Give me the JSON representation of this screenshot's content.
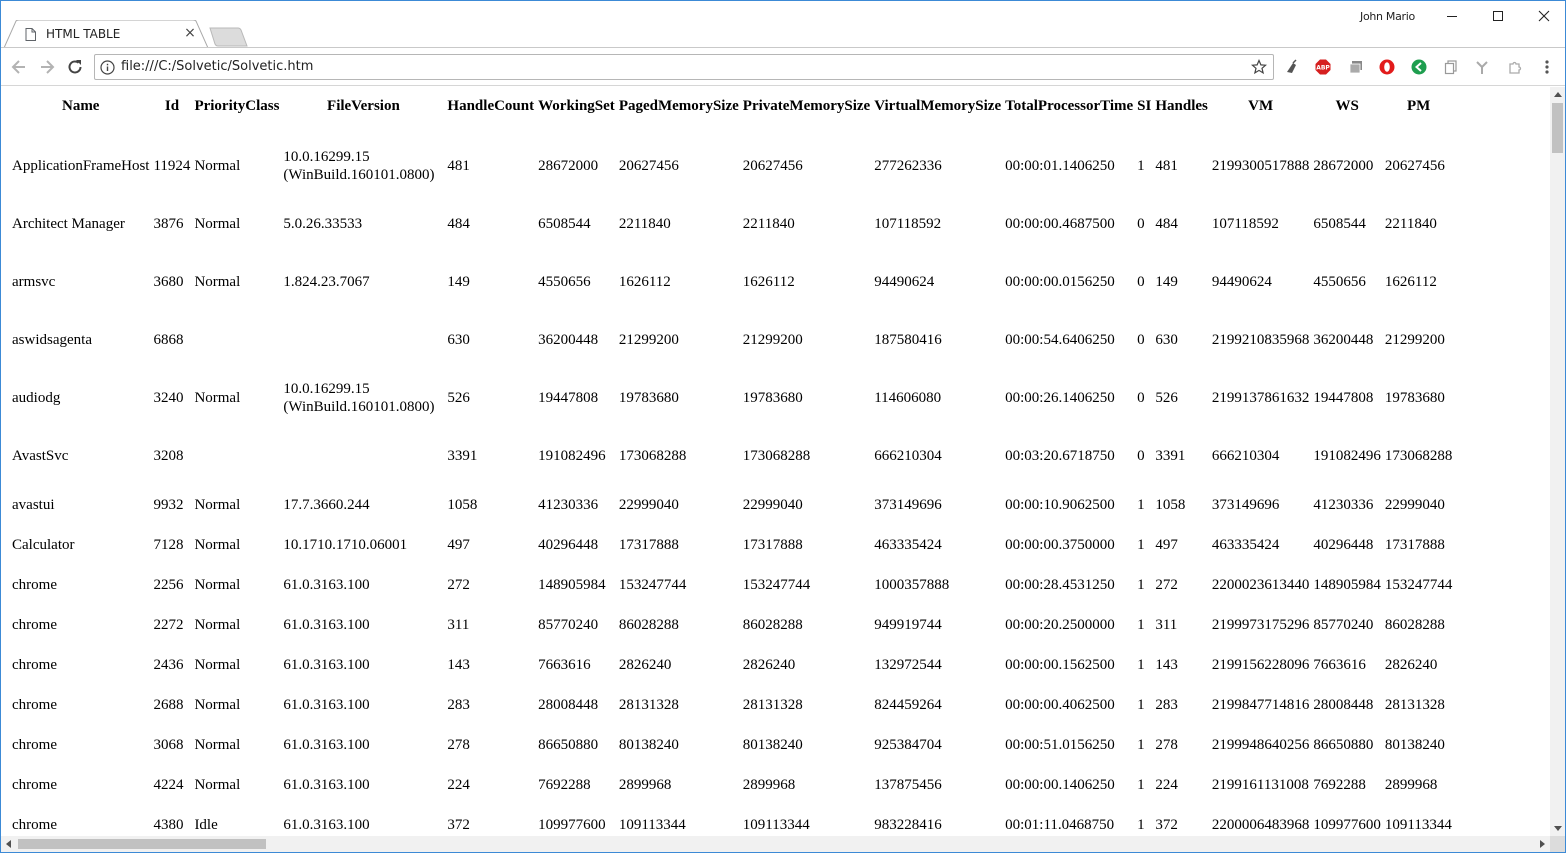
{
  "tab": {
    "title": "HTML TABLE"
  },
  "profile": {
    "name": "John Mario"
  },
  "omnibox": {
    "url": "file:///C:/Solvetic/Solvetic.htm"
  },
  "table": {
    "headers": [
      "Name",
      "Id",
      "PriorityClass",
      "FileVersion",
      "HandleCount",
      "WorkingSet",
      "PagedMemorySize",
      "PrivateMemorySize",
      "VirtualMemorySize",
      "TotalProcessorTime",
      "SI",
      "Handles",
      "VM",
      "WS",
      "PM"
    ],
    "rows": [
      {
        "cells": [
          "ApplicationFrameHost",
          "11924",
          "Normal",
          "10.0.16299.15 (WinBuild.160101.0800)",
          "481",
          "28672000",
          "20627456",
          "20627456",
          "277262336",
          "00:00:01.1406250",
          "1",
          "481",
          "2199300517888",
          "28672000",
          "20627456"
        ]
      },
      {
        "cells": [
          "Architect Manager",
          "3876",
          "Normal",
          "5.0.26.33533",
          "484",
          "6508544",
          "2211840",
          "2211840",
          "107118592",
          "00:00:00.4687500",
          "0",
          "484",
          "107118592",
          "6508544",
          "2211840"
        ]
      },
      {
        "cells": [
          "armsvc",
          "3680",
          "Normal",
          "1.824.23.7067",
          "149",
          "4550656",
          "1626112",
          "1626112",
          "94490624",
          "00:00:00.0156250",
          "0",
          "149",
          "94490624",
          "4550656",
          "1626112"
        ]
      },
      {
        "cells": [
          "aswidsagenta",
          "6868",
          "",
          "",
          "630",
          "36200448",
          "21299200",
          "21299200",
          "187580416",
          "00:00:54.6406250",
          "0",
          "630",
          "2199210835968",
          "36200448",
          "21299200"
        ]
      },
      {
        "cells": [
          "audiodg",
          "3240",
          "Normal",
          "10.0.16299.15 (WinBuild.160101.0800)",
          "526",
          "19447808",
          "19783680",
          "19783680",
          "114606080",
          "00:00:26.1406250",
          "0",
          "526",
          "2199137861632",
          "19447808",
          "19783680"
        ]
      },
      {
        "cells": [
          "AvastSvc",
          "3208",
          "",
          "",
          "3391",
          "191082496",
          "173068288",
          "173068288",
          "666210304",
          "00:03:20.6718750",
          "0",
          "3391",
          "666210304",
          "191082496",
          "173068288"
        ]
      },
      {
        "cells": [
          "avastui",
          "9932",
          "Normal",
          "17.7.3660.244",
          "1058",
          "41230336",
          "22999040",
          "22999040",
          "373149696",
          "00:00:10.9062500",
          "1",
          "1058",
          "373149696",
          "41230336",
          "22999040"
        ]
      },
      {
        "cells": [
          "Calculator",
          "7128",
          "Normal",
          "10.1710.1710.06001",
          "497",
          "40296448",
          "17317888",
          "17317888",
          "463335424",
          "00:00:00.3750000",
          "1",
          "497",
          "463335424",
          "40296448",
          "17317888"
        ]
      },
      {
        "cells": [
          "chrome",
          "2256",
          "Normal",
          "61.0.3163.100",
          "272",
          "148905984",
          "153247744",
          "153247744",
          "1000357888",
          "00:00:28.4531250",
          "1",
          "272",
          "2200023613440",
          "148905984",
          "153247744"
        ]
      },
      {
        "cells": [
          "chrome",
          "2272",
          "Normal",
          "61.0.3163.100",
          "311",
          "85770240",
          "86028288",
          "86028288",
          "949919744",
          "00:00:20.2500000",
          "1",
          "311",
          "2199973175296",
          "85770240",
          "86028288"
        ]
      },
      {
        "cells": [
          "chrome",
          "2436",
          "Normal",
          "61.0.3163.100",
          "143",
          "7663616",
          "2826240",
          "2826240",
          "132972544",
          "00:00:00.1562500",
          "1",
          "143",
          "2199156228096",
          "7663616",
          "2826240"
        ]
      },
      {
        "cells": [
          "chrome",
          "2688",
          "Normal",
          "61.0.3163.100",
          "283",
          "28008448",
          "28131328",
          "28131328",
          "824459264",
          "00:00:00.4062500",
          "1",
          "283",
          "2199847714816",
          "28008448",
          "28131328"
        ]
      },
      {
        "cells": [
          "chrome",
          "3068",
          "Normal",
          "61.0.3163.100",
          "278",
          "86650880",
          "80138240",
          "80138240",
          "925384704",
          "00:00:51.0156250",
          "1",
          "278",
          "2199948640256",
          "86650880",
          "80138240"
        ]
      },
      {
        "cells": [
          "chrome",
          "4224",
          "Normal",
          "61.0.3163.100",
          "224",
          "7692288",
          "2899968",
          "2899968",
          "137875456",
          "00:00:00.1406250",
          "1",
          "224",
          "2199161131008",
          "7692288",
          "2899968"
        ]
      },
      {
        "cells": [
          "chrome",
          "4380",
          "Idle",
          "61.0.3163.100",
          "372",
          "109977600",
          "109113344",
          "109113344",
          "983228416",
          "00:01:11.0468750",
          "1",
          "372",
          "2200006483968",
          "109977600",
          "109113344"
        ]
      }
    ]
  }
}
